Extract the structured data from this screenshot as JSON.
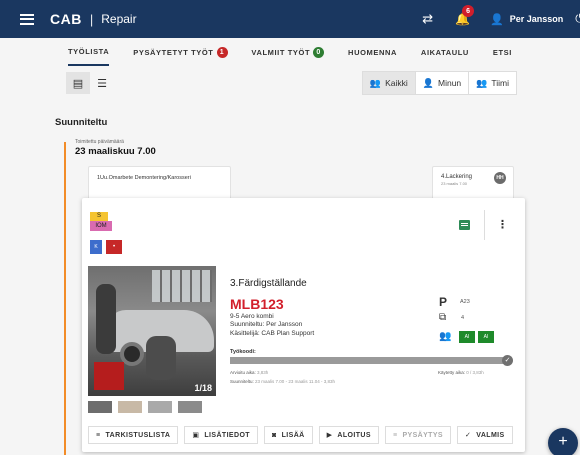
{
  "header": {
    "brand": "CAB",
    "separator": "|",
    "app_title": "Repair",
    "notification_count": "6",
    "user_name": "Per Jansson"
  },
  "tabs": [
    {
      "label": "TYÖLISTA",
      "active": true
    },
    {
      "label": "PYSÄYTETYT TYÖT",
      "badge": "1",
      "badge_color": "#c62828"
    },
    {
      "label": "VALMIIT TYÖT",
      "badge": "0",
      "badge_color": "#2e7d32"
    },
    {
      "label": "HUOMENNA"
    },
    {
      "label": "AIKATAULU"
    },
    {
      "label": "ETSI"
    }
  ],
  "filters": {
    "all": "Kaikki",
    "mine": "Minun",
    "team": "Tiimi"
  },
  "section_title": "Suunniteltu",
  "timeline": {
    "label": "Toimitettu päivämäärä",
    "date": "23 maaliskuu 7.00"
  },
  "mini_cards": {
    "first_title": "1Uu.Omarbete Demontering/Karosseri",
    "second_title": "4.Lackering",
    "second_sub": "23 maalis 7.00",
    "second_initials": "HH"
  },
  "card": {
    "tag_s": "S",
    "tag_iom": "IOM",
    "tag_k": "K",
    "tag_dot": "•",
    "step_title": "3.Färdigställande",
    "plate": "MLB123",
    "car_model": "9-5 Aero kombi",
    "planner": "Suunniteltu: Per Jansson",
    "handler": "Käsittelijä: CAB Plan Support",
    "p_value": "A23",
    "puzzle_value": "4",
    "ai_label_1": "AI",
    "ai_label_2": "AI",
    "work_label": "Työkoodi:",
    "progress": 0.99,
    "est_time_label": "Arvioitu aika:",
    "est_time_value": "3,83h",
    "used_time_label": "Käytetty aika:",
    "used_time_value": "0 / 3,83h",
    "scheduled_label": "Suunniteltu:",
    "scheduled_value": "23 maalis 7.00 - 23 maalis 11.04 - 3,83h",
    "photo_counter": "1/18"
  },
  "actions": [
    {
      "label": "TARKISTUSLISTA",
      "icon": "≡"
    },
    {
      "label": "LISÄTIEDOT",
      "icon": "▣"
    },
    {
      "label": "LISÄÄ",
      "icon": "◙"
    },
    {
      "label": "ALOITUS",
      "icon": "▶"
    },
    {
      "label": "PYSÄYTYS",
      "icon": "≡",
      "disabled": true
    },
    {
      "label": "VALMIS",
      "icon": "✓"
    }
  ],
  "colors": {
    "header_bg": "#1a3760",
    "timeline": "#f28c28",
    "plate": "#d21f2b",
    "ai_green": "#1e8a2a"
  }
}
